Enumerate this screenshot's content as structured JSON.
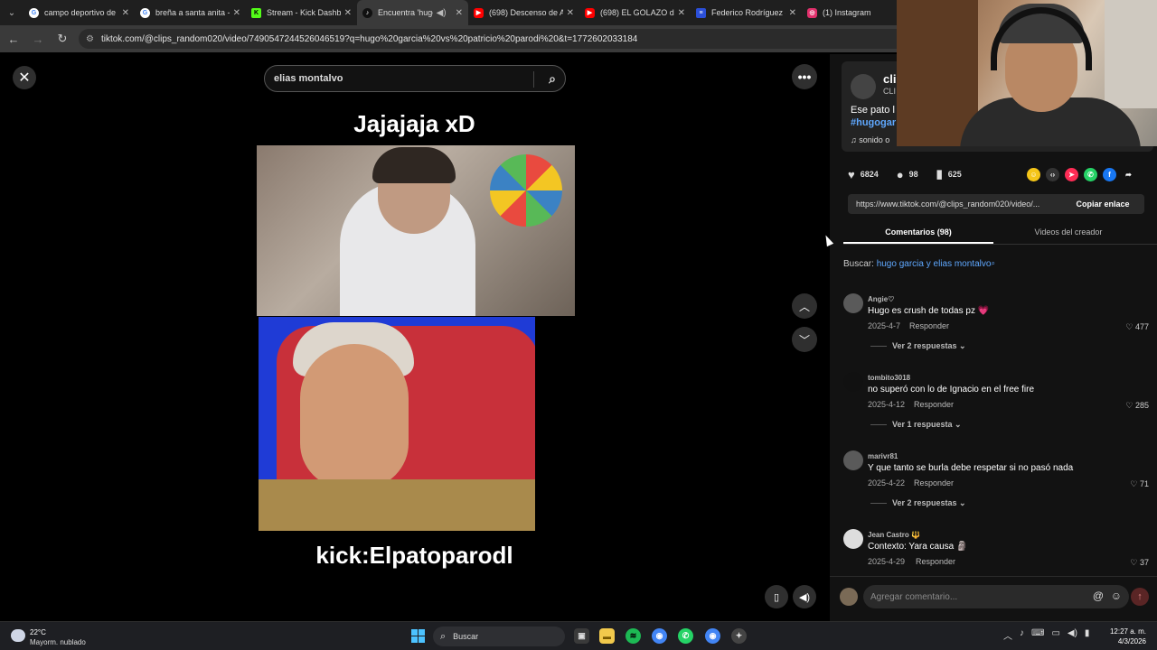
{
  "browser": {
    "tabs": [
      {
        "title": "campo deportivo de",
        "favicon": "google-icon",
        "color": "#4285f4",
        "active": false
      },
      {
        "title": "breña a santa anita -",
        "favicon": "google-icon",
        "color": "#4285f4",
        "active": false
      },
      {
        "title": "Stream - Kick Dashbo",
        "favicon": "kick-icon",
        "color": "#53fc18",
        "active": false
      },
      {
        "title": "Encuentra 'hugo",
        "favicon": "tiktok-icon",
        "color": "#111111",
        "active": true
      },
      {
        "title": "(698) Descenso de Al",
        "favicon": "youtube-icon",
        "color": "#ff0000",
        "active": false
      },
      {
        "title": "(698) EL GOLAZO de",
        "favicon": "youtube-icon",
        "color": "#ff0000",
        "active": false
      },
      {
        "title": "Federico Rodríguez -",
        "favicon": "site-icon",
        "color": "#2b4fd8",
        "active": false
      },
      {
        "title": "(1) Instagram",
        "favicon": "instagram-icon",
        "color": "#e1306c",
        "active": false
      }
    ],
    "url": "tiktok.com/@clips_random020/video/7490547244526046519?q=hugo%20garcia%20vs%20patricio%20parodi%20&t=1772602033184"
  },
  "video": {
    "search_value": "elias montalvo",
    "caption_top": "Jajajaja xD",
    "caption_bottom": "kick:Elpatoparodl"
  },
  "author": {
    "name": "cli",
    "handle": "CLI",
    "description": "Ese pato l",
    "hashtag": "#hugogar",
    "sound": "sonido o"
  },
  "stats": {
    "likes": "6824",
    "comments": "98",
    "saves": "625"
  },
  "share_link": {
    "url": "https://www.tiktok.com/@clips_random020/video/...",
    "copy_label": "Copiar enlace"
  },
  "panel_tabs": {
    "comments": "Comentarios (98)",
    "creator_videos": "Videos del creador"
  },
  "find": {
    "label": "Buscar:",
    "query": "hugo garcia y elias montalvo"
  },
  "comments": [
    {
      "user": "Angie♡",
      "text": "Hugo es crush de todas pz 💗",
      "date": "2025-4-7",
      "reply": "Responder",
      "likes": "477",
      "more": "Ver 2 respuestas ⌄",
      "avatar_color": "#7a7a7a"
    },
    {
      "user": "tombito3018",
      "text": "no superó con lo de Ignacio en el free fire",
      "date": "2025-4-12",
      "reply": "Responder",
      "likes": "285",
      "more": "Ver 1 respuesta ⌄",
      "avatar_color": "#111111"
    },
    {
      "user": "marivr81",
      "text": "Y que tanto se burla debe respetar si no pasó nada",
      "date": "2025-4-22",
      "reply": "Responder",
      "likes": "71",
      "more": "Ver 2 respuestas ⌄",
      "avatar_color": "#6a6a6a"
    },
    {
      "user": "Jean Castro 🔱",
      "text": "Contexto: Yara causa 🗿",
      "date": "2025-4-29",
      "reply": "Responder",
      "likes": "37",
      "more": "",
      "avatar_color": "#dddddd"
    }
  ],
  "compose": {
    "placeholder": "Agregar comentario..."
  },
  "taskbar": {
    "temperature": "22°C",
    "condition": "Mayorm. nublado",
    "search_label": "Buscar",
    "time": "12:27 a. m.",
    "date": "4/3/2026"
  }
}
